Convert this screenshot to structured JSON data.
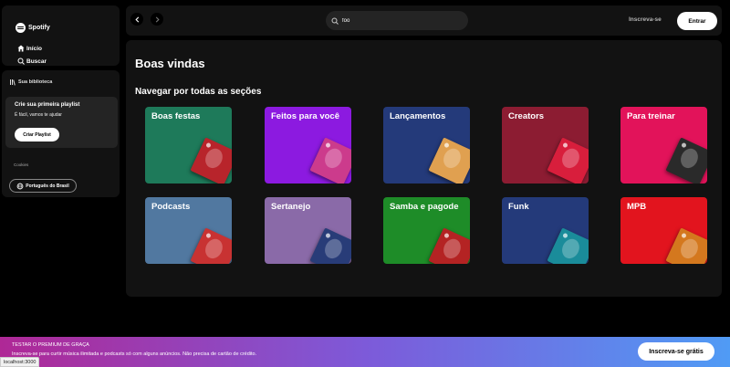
{
  "sidebar": {
    "logo_text": "Spotify",
    "nav": [
      {
        "label": "Início",
        "icon": "home-icon"
      },
      {
        "label": "Buscar",
        "icon": "search-icon"
      }
    ],
    "library": {
      "title": "Sua biblioteca",
      "icon": "library-icon",
      "playlist_card": {
        "title": "Crie sua primeira playlist",
        "subtitle": "É fácil, vamos te ajudar",
        "button": "Criar Playlist"
      },
      "cookies": "Cookies",
      "language_button": "Português do Brasil",
      "language_icon": "globe-icon"
    }
  },
  "topbar": {
    "back_icon": "chevron-left-icon",
    "forward_icon": "chevron-right-icon",
    "search_value": "foo",
    "search_icon": "search-icon",
    "signup_label": "Inscreva-se",
    "login_label": "Entrar"
  },
  "main": {
    "welcome": "Boas vindas",
    "browse_title": "Navegar por todas as seções",
    "cards": [
      {
        "title": "Boas festas",
        "color": "#1e7a5a",
        "art": "#b8242b"
      },
      {
        "title": "Feitos para você",
        "color": "#8c1ae0",
        "art": "#cc3b8c"
      },
      {
        "title": "Lançamentos",
        "color": "#243a7a",
        "art": "#e0a050"
      },
      {
        "title": "Creators",
        "color": "#8c1c32",
        "art": "#d81e3c"
      },
      {
        "title": "Para treinar",
        "color": "#e2135a",
        "art": "#2a2a2a"
      },
      {
        "title": "Podcasts",
        "color": "#5178a0",
        "art": "#c83232"
      },
      {
        "title": "Sertanejo",
        "color": "#8a6aa8",
        "art": "#283c78"
      },
      {
        "title": "Samba e pagode",
        "color": "#1e8c28",
        "art": "#b42323"
      },
      {
        "title": "Funk",
        "color": "#243a7a",
        "art": "#1a8c9a"
      },
      {
        "title": "MPB",
        "color": "#e2141e",
        "art": "#d4781e"
      }
    ]
  },
  "banner": {
    "title": "TESTAR O PREMIUM DE GRAÇA",
    "subtitle": "Inscreva-se para curtir música ilimitada e podcasts só com alguns anúncios. Não precisa de cartão de crédito.",
    "button": "Inscreva-se grátis"
  },
  "status_url": "localhost:3000"
}
